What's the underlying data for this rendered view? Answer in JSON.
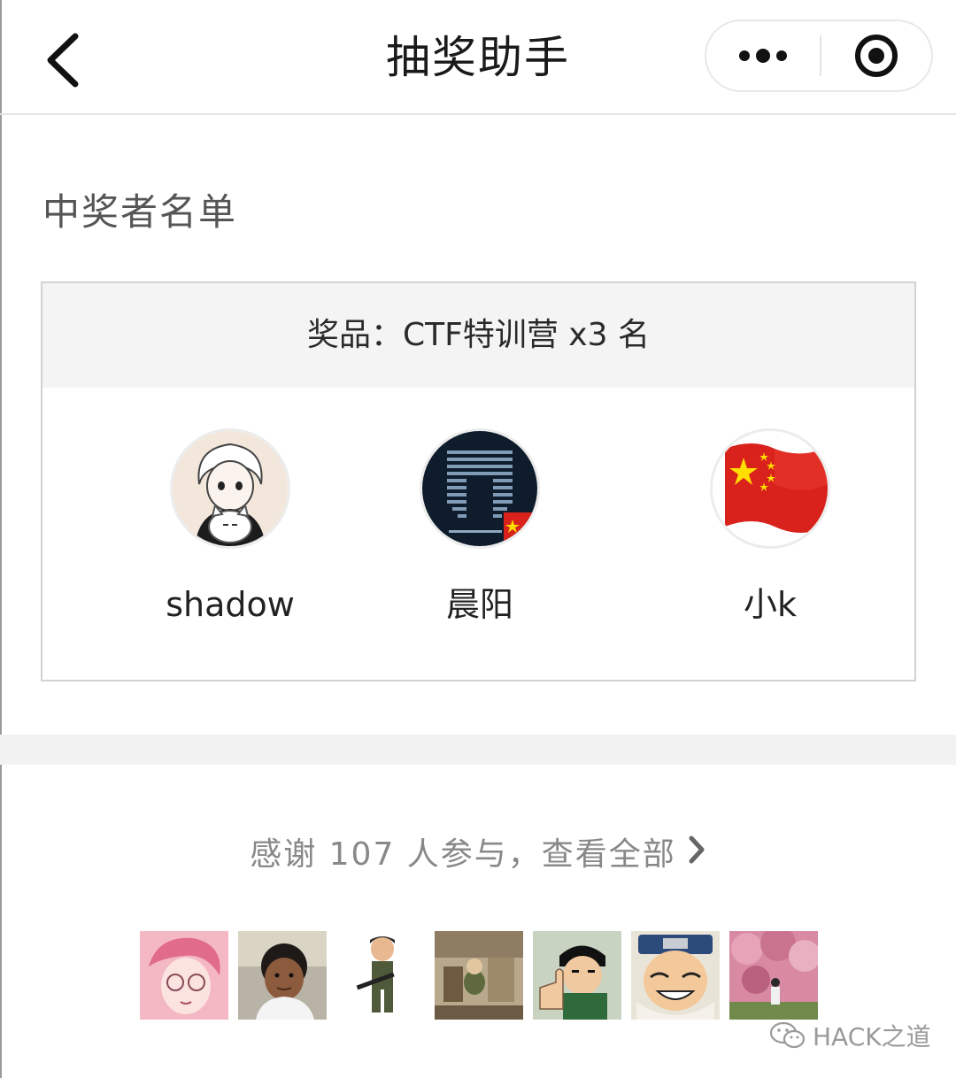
{
  "nav": {
    "title": "抽奖助手"
  },
  "section": {
    "title": "中奖者名单"
  },
  "prize": {
    "header": "奖品：CTF特训营 x3 名",
    "winners": [
      {
        "name": "shadow",
        "avatar": "anime-boy-with-cat-avatar"
      },
      {
        "name": "晨阳",
        "avatar": "terminal-ascii-art-avatar"
      },
      {
        "name": "小k",
        "avatar": "china-flag-avatar"
      }
    ]
  },
  "participation": {
    "text": "感谢 107 人参与，查看全部",
    "avatars": [
      "pink-anime-boy-avatar",
      "kid-photo-avatar",
      "soldier-figure-avatar",
      "cartoon-scene-avatar",
      "thumbs-up-anime-avatar",
      "naruto-avatar",
      "cherry-blossom-photo-avatar"
    ]
  },
  "watermark": {
    "text": "HACK之道"
  },
  "colors": {
    "nav_text": "#1a1a1a",
    "muted": "#888888",
    "header_bg": "#f4f4f4",
    "flag_red": "#d9221c",
    "flag_star": "#ffde00"
  }
}
